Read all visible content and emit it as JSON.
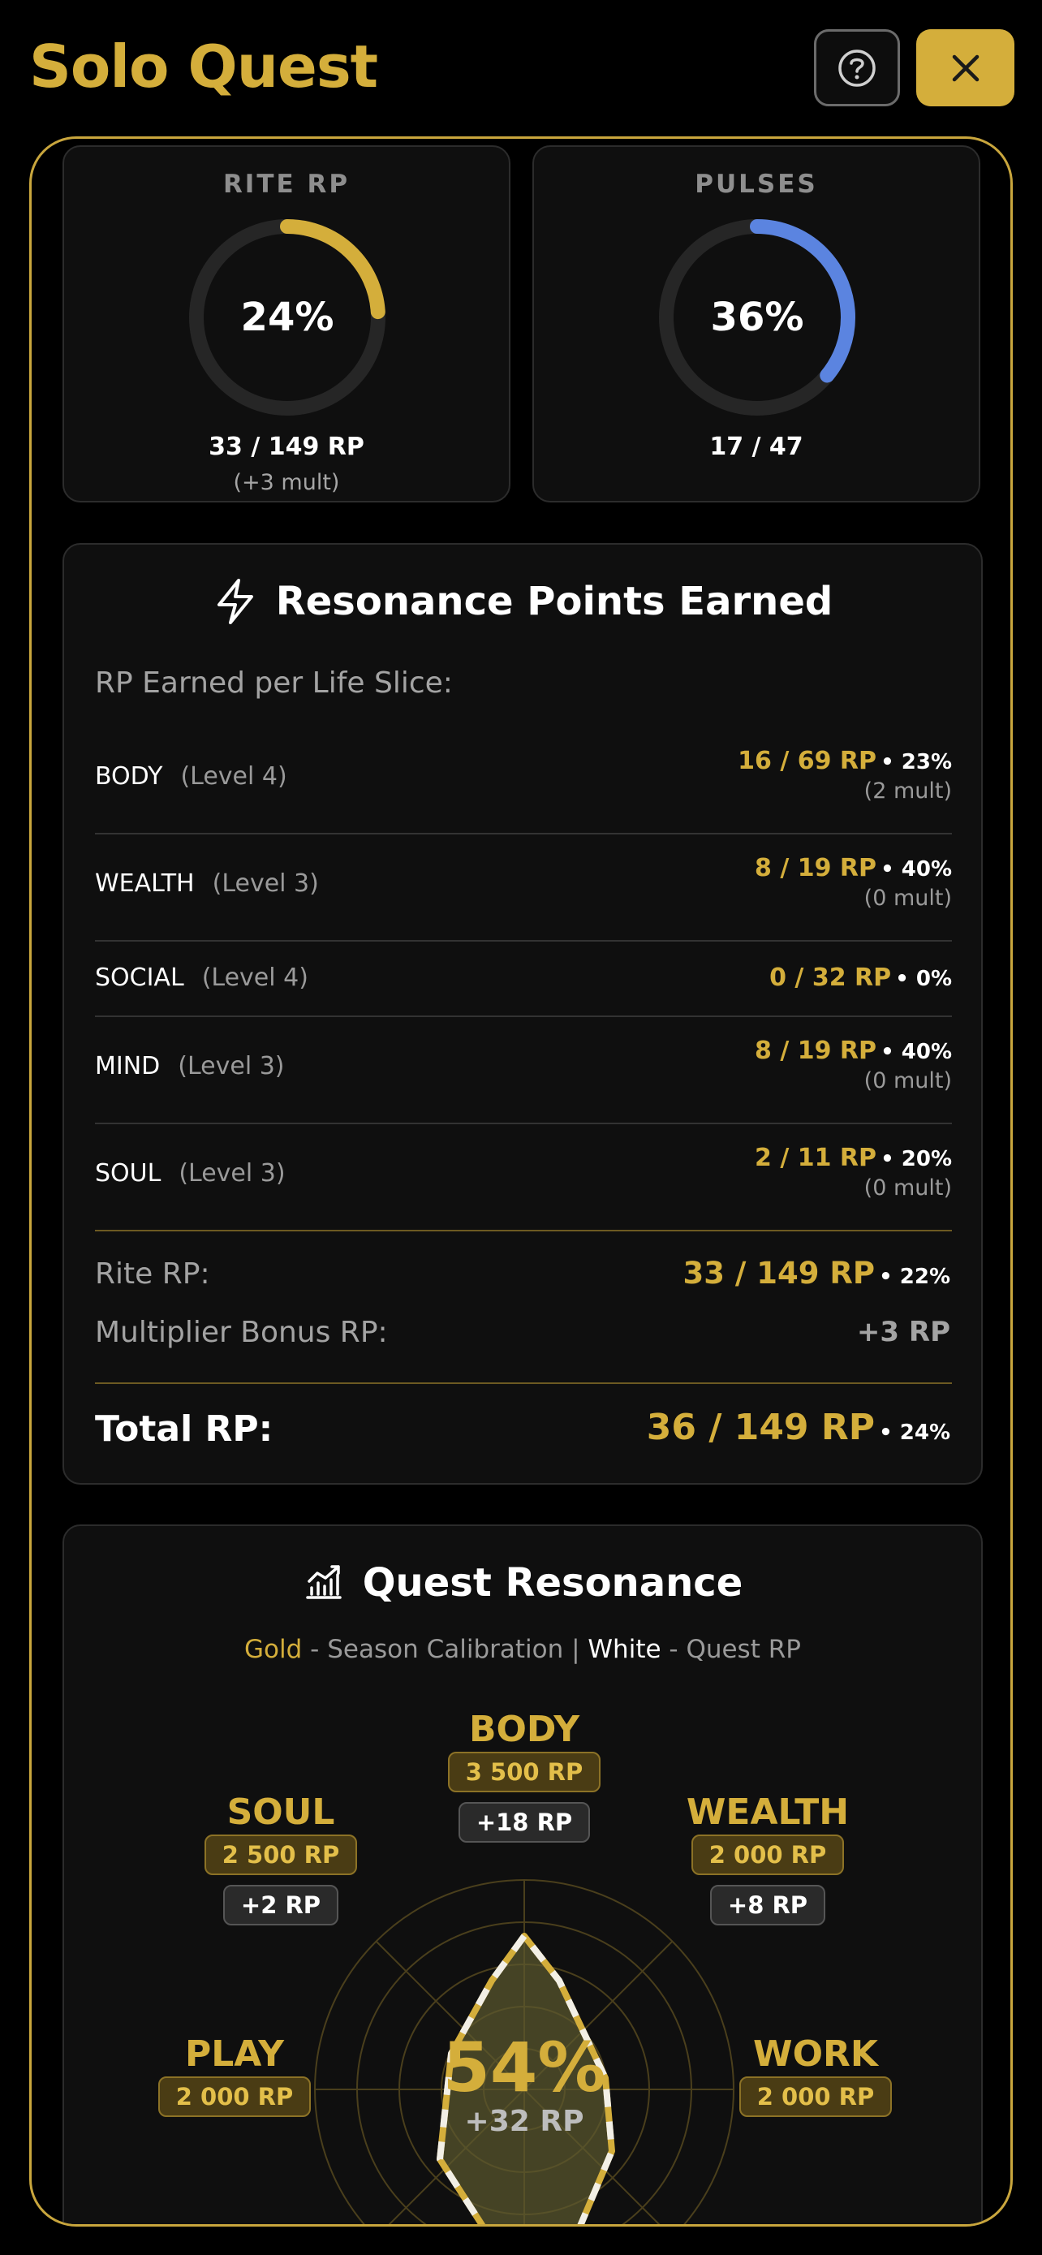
{
  "app": {
    "title": "Solo Quest",
    "icons": {
      "help": "question-circle-icon",
      "close": "close-x-icon"
    }
  },
  "colors": {
    "gold": "#d4ae3b",
    "blue": "#5b84e0",
    "background": "#000000"
  },
  "stats": {
    "rite_rp": {
      "label": "RITE RP",
      "percent_text": "24%",
      "progress": 0.24,
      "value_text": "33 / 149 RP",
      "mult_text": "(+3 mult)"
    },
    "pulses": {
      "label": "PULSES",
      "percent_text": "36%",
      "progress": 0.36,
      "value_text": "17 / 47"
    }
  },
  "rp_card": {
    "icon": "lightning-icon",
    "title": "Resonance Points Earned",
    "subtitle": "RP Earned per Life Slice:",
    "slices": [
      {
        "name": "BODY",
        "level": "(Level 4)",
        "value": "16 / 69 RP",
        "pct": "• 23%",
        "mult": "(2 mult)"
      },
      {
        "name": "WEALTH",
        "level": "(Level 3)",
        "value": "8 / 19 RP",
        "pct": "• 40%",
        "mult": "(0 mult)"
      },
      {
        "name": "SOCIAL",
        "level": "(Level 4)",
        "value": "0 / 32 RP",
        "pct": "• 0%",
        "mult": ""
      },
      {
        "name": "MIND",
        "level": "(Level 3)",
        "value": "8 / 19 RP",
        "pct": "• 40%",
        "mult": "(0 mult)"
      },
      {
        "name": "SOUL",
        "level": "(Level 3)",
        "value": "2 / 11 RP",
        "pct": "• 20%",
        "mult": "(0 mult)"
      }
    ],
    "rite_label": "Rite RP:",
    "rite_value": "33 / 149 RP",
    "rite_pct": "• 22%",
    "bonus_label": "Multiplier Bonus RP:",
    "bonus_value": "+3 RP",
    "total_label": "Total RP:",
    "total_value": "36 / 149 RP",
    "total_pct": "• 24%"
  },
  "quest_resonance": {
    "icon": "bar-chart-trend-icon",
    "title": "Quest Resonance",
    "legend": {
      "gold_word": "Gold",
      "gold_desc": " - Season Calibration | ",
      "white_word": "White",
      "white_desc": " - Quest RP"
    },
    "axes": {
      "body": {
        "name": "BODY",
        "calibration": "3 500 RP",
        "quest": "+18 RP"
      },
      "soul": {
        "name": "SOUL",
        "calibration": "2 500 RP",
        "quest": "+2 RP"
      },
      "wealth": {
        "name": "WEALTH",
        "calibration": "2 000 RP",
        "quest": "+8 RP"
      },
      "play": {
        "name": "PLAY",
        "calibration": "2 000 RP"
      },
      "work": {
        "name": "WORK",
        "calibration": "2 000 RP"
      }
    },
    "center_percent": "54%",
    "center_rp": "+32 RP"
  }
}
